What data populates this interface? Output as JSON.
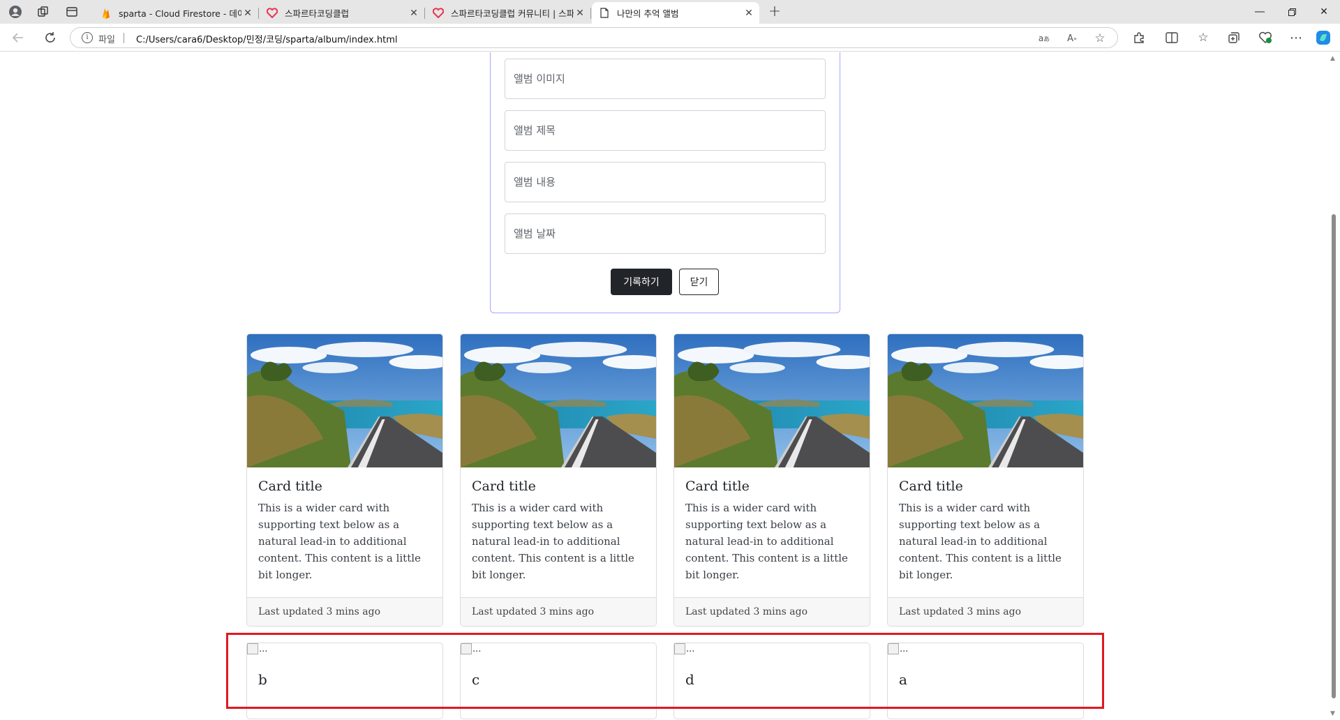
{
  "browser": {
    "tabs": [
      {
        "title": "sparta - Cloud Firestore - 데이터",
        "favicon": "firebase-icon",
        "active": false
      },
      {
        "title": "스파르타코딩클럽",
        "favicon": "sparta-heart-icon",
        "active": false
      },
      {
        "title": "스파르타코딩클럽 커뮤니티 | 스파",
        "favicon": "sparta-heart-icon",
        "active": false
      },
      {
        "title": "나만의 추억 앨범",
        "favicon": "page-icon",
        "active": true
      }
    ],
    "address": {
      "scheme_label": "파일",
      "url": "C:/Users/cara6/Desktop/민정/코딩/sparta/album/index.html"
    }
  },
  "form": {
    "fields": [
      {
        "placeholder": "앨범 이미지"
      },
      {
        "placeholder": "앨범 제목"
      },
      {
        "placeholder": "앨범 내용"
      },
      {
        "placeholder": "앨범 날짜"
      }
    ],
    "submit_label": "기록하기",
    "close_label": "닫기"
  },
  "cards": [
    {
      "title": "Card title",
      "text": "This is a wider card with supporting text below as a natural lead-in to additional content. This content is a little bit longer.",
      "footer": "Last updated 3 mins ago"
    },
    {
      "title": "Card title",
      "text": "This is a wider card with supporting text below as a natural lead-in to additional content. This content is a little bit longer.",
      "footer": "Last updated 3 mins ago"
    },
    {
      "title": "Card title",
      "text": "This is a wider card with supporting text below as a natural lead-in to additional content. This content is a little bit longer.",
      "footer": "Last updated 3 mins ago"
    },
    {
      "title": "Card title",
      "text": "This is a wider card with supporting text below as a natural lead-in to additional content. This content is a little bit longer.",
      "footer": "Last updated 3 mins ago"
    }
  ],
  "mini_cards": [
    {
      "alt": "...",
      "title": "b"
    },
    {
      "alt": "...",
      "title": "c"
    },
    {
      "alt": "...",
      "title": "d"
    },
    {
      "alt": "...",
      "title": "a"
    }
  ],
  "colors": {
    "form_border": "#a5a7ff",
    "highlight": "#e0191f",
    "dark_button": "#212529"
  }
}
